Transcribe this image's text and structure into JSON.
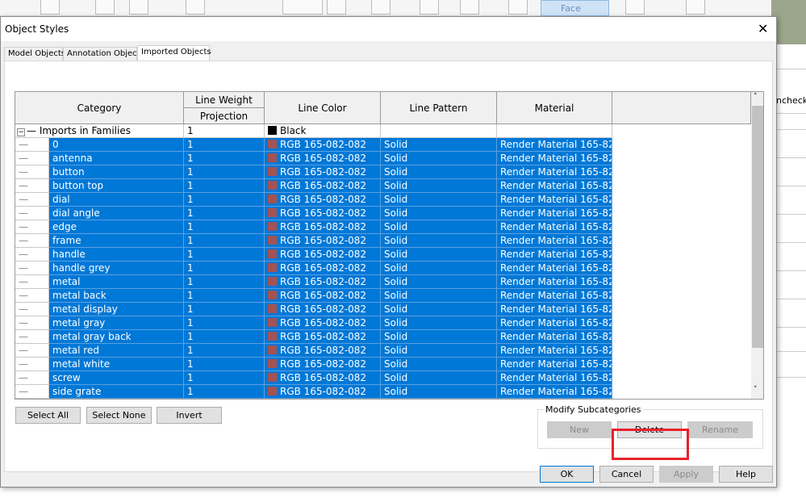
{
  "background": {
    "face_label": "Face",
    "unchecked_label": "nchecked"
  },
  "dialog": {
    "title": "Object Styles",
    "tabs": [
      {
        "label": "Model Objects"
      },
      {
        "label": "Annotation Objects"
      },
      {
        "label": "Imported Objects",
        "active": true
      }
    ]
  },
  "table": {
    "headers": {
      "category": "Category",
      "line_weight": "Line Weight",
      "projection": "Projection",
      "line_color": "Line Color",
      "line_pattern": "Line Pattern",
      "material": "Material"
    },
    "parent": {
      "category": "Imports in Families",
      "projection": "1",
      "line_color": "Black",
      "line_color_hex": "#000000",
      "line_pattern": "",
      "material": ""
    },
    "selection_color": "#0078d7",
    "rows": [
      {
        "category": "0",
        "projection": "1",
        "line_color": "RGB 165-082-082",
        "line_pattern": "Solid",
        "material": "Render Material 165-82-..."
      },
      {
        "category": "antenna",
        "projection": "1",
        "line_color": "RGB 165-082-082",
        "line_pattern": "Solid",
        "material": "Render Material 165-82-..."
      },
      {
        "category": "button",
        "projection": "1",
        "line_color": "RGB 165-082-082",
        "line_pattern": "Solid",
        "material": "Render Material 165-82-..."
      },
      {
        "category": "button top",
        "projection": "1",
        "line_color": "RGB 165-082-082",
        "line_pattern": "Solid",
        "material": "Render Material 165-82-..."
      },
      {
        "category": "dial",
        "projection": "1",
        "line_color": "RGB 165-082-082",
        "line_pattern": "Solid",
        "material": "Render Material 165-82-..."
      },
      {
        "category": "dial angle",
        "projection": "1",
        "line_color": "RGB 165-082-082",
        "line_pattern": "Solid",
        "material": "Render Material 165-82-..."
      },
      {
        "category": "edge",
        "projection": "1",
        "line_color": "RGB 165-082-082",
        "line_pattern": "Solid",
        "material": "Render Material 165-82-..."
      },
      {
        "category": "frame",
        "projection": "1",
        "line_color": "RGB 165-082-082",
        "line_pattern": "Solid",
        "material": "Render Material 165-82-..."
      },
      {
        "category": "handle",
        "projection": "1",
        "line_color": "RGB 165-082-082",
        "line_pattern": "Solid",
        "material": "Render Material 165-82-..."
      },
      {
        "category": "handle grey",
        "projection": "1",
        "line_color": "RGB 165-082-082",
        "line_pattern": "Solid",
        "material": "Render Material 165-82-..."
      },
      {
        "category": "metal",
        "projection": "1",
        "line_color": "RGB 165-082-082",
        "line_pattern": "Solid",
        "material": "Render Material 165-82-..."
      },
      {
        "category": "metal back",
        "projection": "1",
        "line_color": "RGB 165-082-082",
        "line_pattern": "Solid",
        "material": "Render Material 165-82-..."
      },
      {
        "category": "metal display",
        "projection": "1",
        "line_color": "RGB 165-082-082",
        "line_pattern": "Solid",
        "material": "Render Material 165-82-..."
      },
      {
        "category": "metal gray",
        "projection": "1",
        "line_color": "RGB 165-082-082",
        "line_pattern": "Solid",
        "material": "Render Material 165-82-..."
      },
      {
        "category": "metal gray back",
        "projection": "1",
        "line_color": "RGB 165-082-082",
        "line_pattern": "Solid",
        "material": "Render Material 165-82-..."
      },
      {
        "category": "metal red",
        "projection": "1",
        "line_color": "RGB 165-082-082",
        "line_pattern": "Solid",
        "material": "Render Material 165-82-..."
      },
      {
        "category": "metal white",
        "projection": "1",
        "line_color": "RGB 165-082-082",
        "line_pattern": "Solid",
        "material": "Render Material 165-82-..."
      },
      {
        "category": "screw",
        "projection": "1",
        "line_color": "RGB 165-082-082",
        "line_pattern": "Solid",
        "material": "Render Material 165-82-..."
      },
      {
        "category": "side grate",
        "projection": "1",
        "line_color": "RGB 165-082-082",
        "line_pattern": "Solid",
        "material": "Render Material 165-82-..."
      }
    ],
    "row_swatch_hex": "#a55252"
  },
  "buttons": {
    "select_all": "Select All",
    "select_none": "Select None",
    "invert": "Invert",
    "modify_group": "Modify Subcategories",
    "new": "New",
    "delete": "Delete",
    "rename": "Rename",
    "ok": "OK",
    "cancel": "Cancel",
    "apply": "Apply",
    "help": "Help"
  },
  "highlight_color": "#e8202a"
}
